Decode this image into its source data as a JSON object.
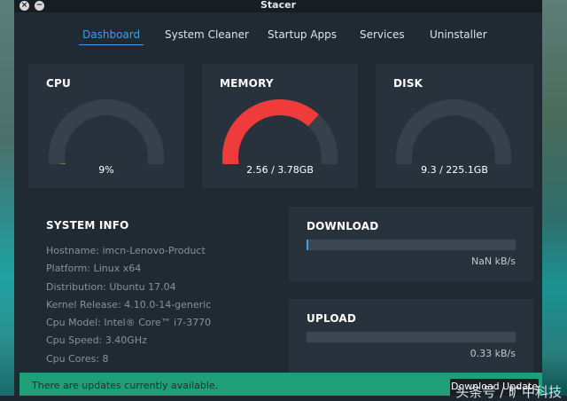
{
  "window": {
    "title": "Stacer"
  },
  "tabs": [
    {
      "label": "Dashboard",
      "active": true
    },
    {
      "label": "System Cleaner",
      "active": false
    },
    {
      "label": "Startup Apps",
      "active": false
    },
    {
      "label": "Services",
      "active": false
    },
    {
      "label": "Uninstaller",
      "active": false
    }
  ],
  "gauges": {
    "cpu": {
      "title": "CPU",
      "text": "9%",
      "fraction": 0.09,
      "color": "#3cb34a"
    },
    "memory": {
      "title": "MEMORY",
      "text": "2.56 / 3.78GB",
      "fraction": 0.677,
      "color": "#f03b3b"
    },
    "disk": {
      "title": "DISK",
      "text": "9.3 / 225.1GB",
      "fraction": 0.041,
      "color": "#e0266f"
    }
  },
  "system_info": {
    "title": "SYSTEM INFO",
    "lines": [
      "Hostname: imcn-Lenovo-Product",
      "Platform: Linux x64",
      "Distribution: Ubuntu 17.04",
      "Kernel Release: 4.10.0-14-generic",
      "Cpu Model: Intel® Core™ i7-3770",
      "Cpu Speed: 3.40GHz",
      "Cpu Cores: 8"
    ]
  },
  "download": {
    "title": "DOWNLOAD",
    "speed": "NaN kB/s",
    "fraction": 0.005
  },
  "upload": {
    "title": "UPLOAD",
    "speed": "0.33 kB/s",
    "fraction": 0.0
  },
  "update": {
    "message": "There are updates currently available.",
    "button_label": "Download Update"
  },
  "watermark": {
    "text": "头条号 / 旷中科技"
  },
  "colors": {
    "accent": "#3aa0e8",
    "track": "#36414b",
    "update_bar": "#1f9f78"
  }
}
